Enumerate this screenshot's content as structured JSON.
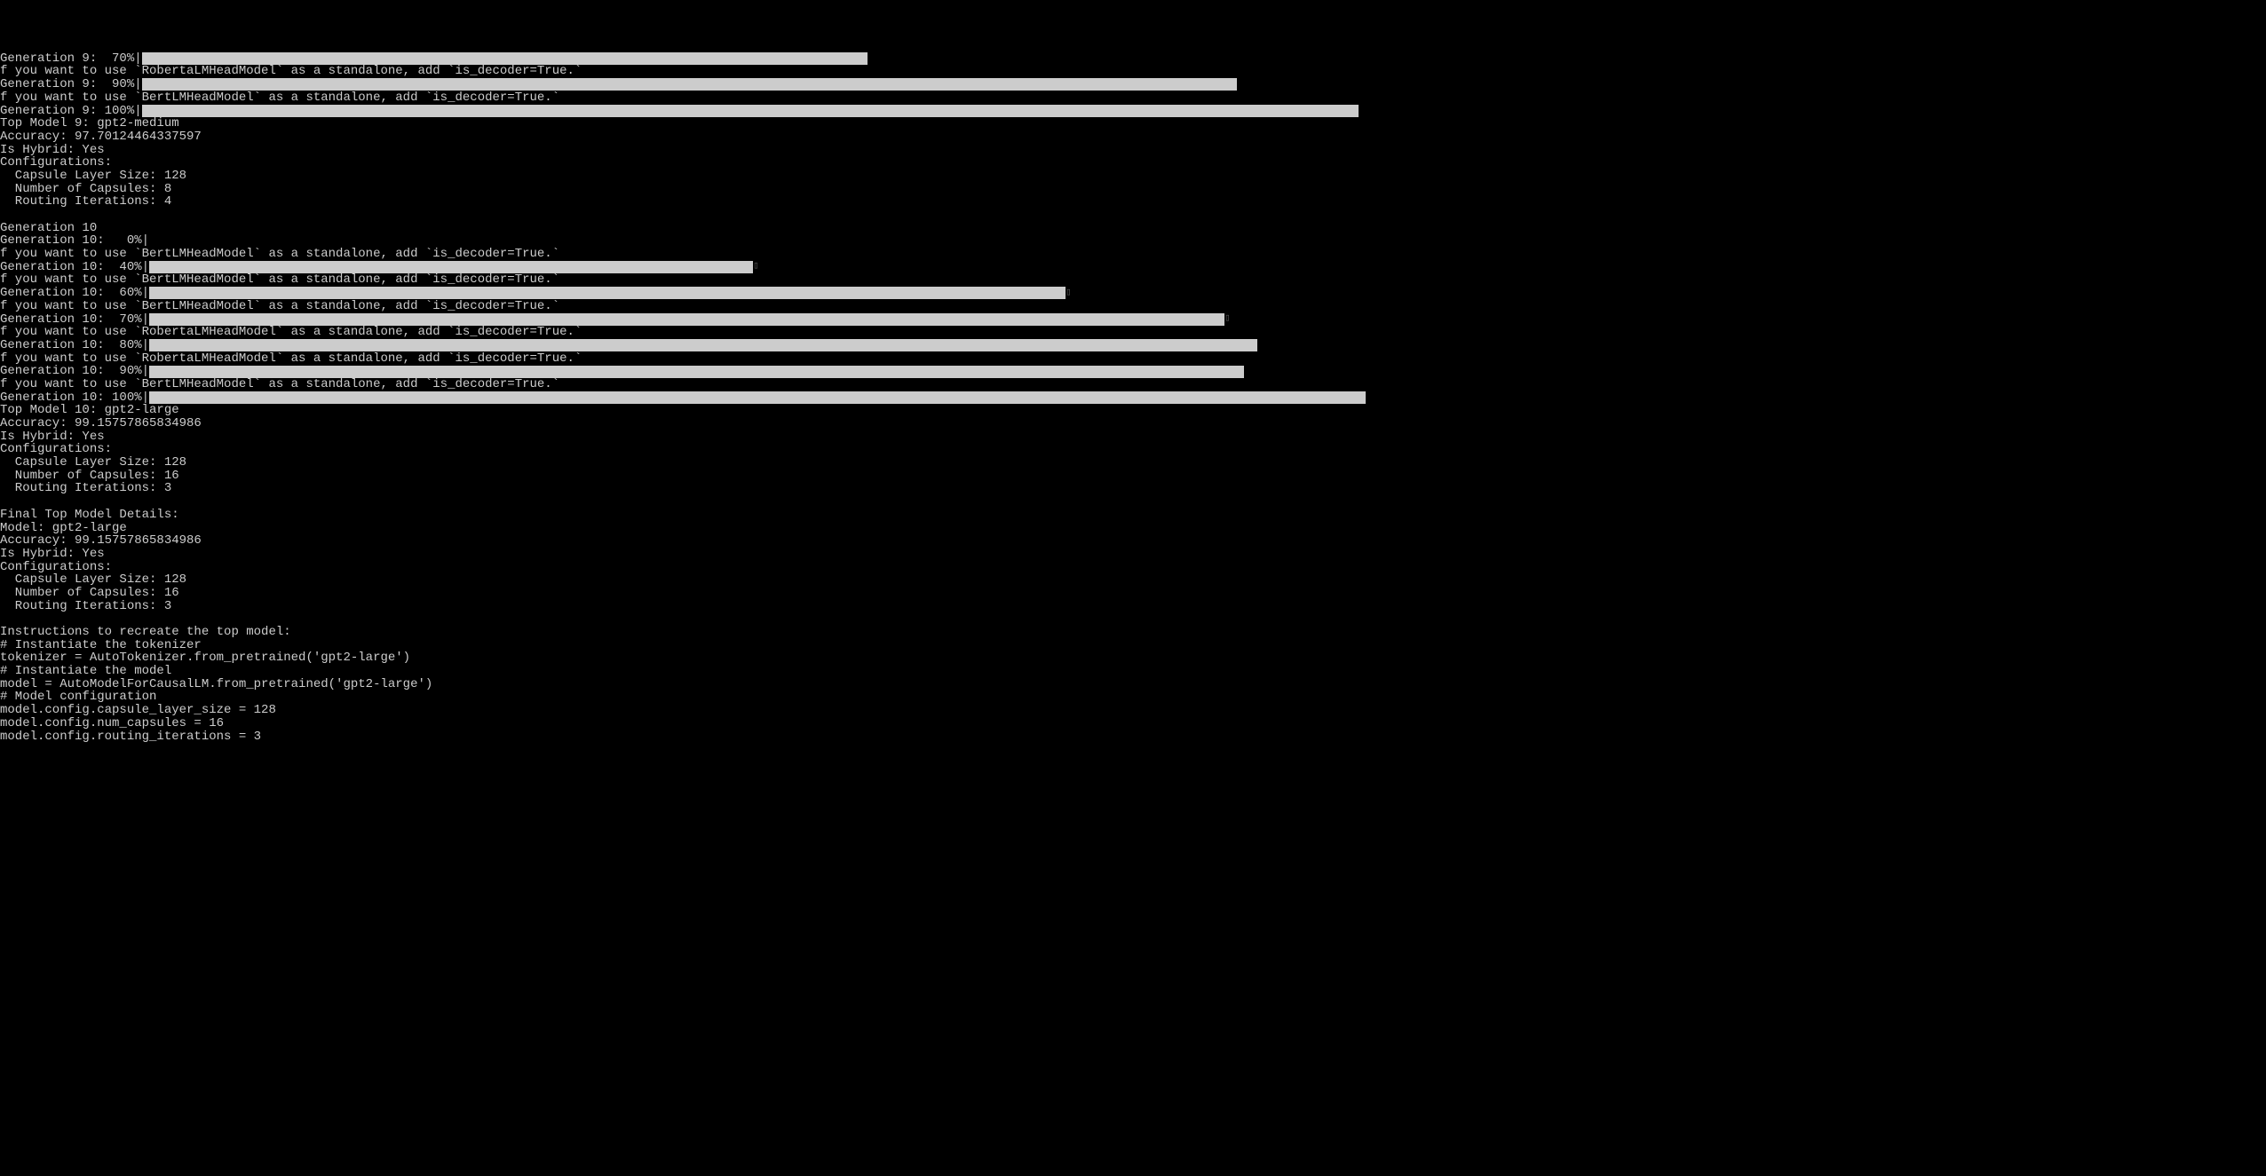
{
  "terminal_width": 1510,
  "lines": [
    {
      "type": "progress",
      "gen": "Generation 9:  70%",
      "percent": 70,
      "max_width": 1307,
      "end": false
    },
    {
      "type": "text",
      "content": "f you want to use `RobertaLMHeadModel` as a standalone, add `is_decoder=True.`"
    },
    {
      "type": "progress",
      "gen": "Generation 9:  90%",
      "percent": 90,
      "max_width": 1510,
      "end": false
    },
    {
      "type": "text",
      "content": "f you want to use `BertLMHeadModel` as a standalone, add `is_decoder=True.`"
    },
    {
      "type": "progress",
      "gen": "Generation 9: 100%",
      "percent": 100,
      "max_width": 1510,
      "end": false
    },
    {
      "type": "text",
      "content": "Top Model 9: gpt2-medium"
    },
    {
      "type": "text",
      "content": "Accuracy: 97.70124464337597"
    },
    {
      "type": "text",
      "content": "Is Hybrid: Yes"
    },
    {
      "type": "text",
      "content": "Configurations:"
    },
    {
      "type": "text",
      "content": "  Capsule Layer Size: 128"
    },
    {
      "type": "text",
      "content": "  Number of Capsules: 8"
    },
    {
      "type": "text",
      "content": "  Routing Iterations: 4"
    },
    {
      "type": "blank"
    },
    {
      "type": "text",
      "content": "Generation 10"
    },
    {
      "type": "progress",
      "gen": "Generation 10:   0%",
      "percent": 0,
      "max_width": 1510,
      "end": false
    },
    {
      "type": "text",
      "content": "f you want to use `BertLMHeadModel` as a standalone, add `is_decoder=True.`"
    },
    {
      "type": "progress",
      "gen": "Generation 10:  40%",
      "percent": 40,
      "max_width": 1840,
      "end": true
    },
    {
      "type": "text",
      "content": "f you want to use `BertLMHeadModel` as a standalone, add `is_decoder=True.`"
    },
    {
      "type": "progress",
      "gen": "Generation 10:  60%",
      "percent": 60,
      "max_width": 1860,
      "end": true
    },
    {
      "type": "text",
      "content": "f you want to use `BertLMHeadModel` as a standalone, add `is_decoder=True.`"
    },
    {
      "type": "progress",
      "gen": "Generation 10:  70%",
      "percent": 70,
      "max_width": 1870,
      "end": true
    },
    {
      "type": "text",
      "content": "f you want to use `RobertaLMHeadModel` as a standalone, add `is_decoder=True.`"
    },
    {
      "type": "progress",
      "gen": "Generation 10:  80%",
      "percent": 80,
      "max_width": 1700,
      "end": false
    },
    {
      "type": "text",
      "content": "f you want to use `RobertaLMHeadModel` as a standalone, add `is_decoder=True.`"
    },
    {
      "type": "progress",
      "gen": "Generation 10:  90%",
      "percent": 90,
      "max_width": 1510,
      "end": false
    },
    {
      "type": "text",
      "content": "f you want to use `BertLMHeadModel` as a standalone, add `is_decoder=True.`"
    },
    {
      "type": "progress",
      "gen": "Generation 10: 100%",
      "percent": 100,
      "max_width": 1510,
      "end": false
    },
    {
      "type": "text",
      "content": "Top Model 10: gpt2-large"
    },
    {
      "type": "text",
      "content": "Accuracy: 99.15757865834986"
    },
    {
      "type": "text",
      "content": "Is Hybrid: Yes"
    },
    {
      "type": "text",
      "content": "Configurations:"
    },
    {
      "type": "text",
      "content": "  Capsule Layer Size: 128"
    },
    {
      "type": "text",
      "content": "  Number of Capsules: 16"
    },
    {
      "type": "text",
      "content": "  Routing Iterations: 3"
    },
    {
      "type": "blank"
    },
    {
      "type": "text",
      "content": "Final Top Model Details:"
    },
    {
      "type": "text",
      "content": "Model: gpt2-large"
    },
    {
      "type": "text",
      "content": "Accuracy: 99.15757865834986"
    },
    {
      "type": "text",
      "content": "Is Hybrid: Yes"
    },
    {
      "type": "text",
      "content": "Configurations:"
    },
    {
      "type": "text",
      "content": "  Capsule Layer Size: 128"
    },
    {
      "type": "text",
      "content": "  Number of Capsules: 16"
    },
    {
      "type": "text",
      "content": "  Routing Iterations: 3"
    },
    {
      "type": "blank"
    },
    {
      "type": "text",
      "content": "Instructions to recreate the top model:"
    },
    {
      "type": "text",
      "content": "# Instantiate the tokenizer"
    },
    {
      "type": "text",
      "content": "tokenizer = AutoTokenizer.from_pretrained('gpt2-large')"
    },
    {
      "type": "text",
      "content": "# Instantiate the model"
    },
    {
      "type": "text",
      "content": "model = AutoModelForCausalLM.from_pretrained('gpt2-large')"
    },
    {
      "type": "text",
      "content": "# Model configuration"
    },
    {
      "type": "text",
      "content": "model.config.capsule_layer_size = 128"
    },
    {
      "type": "text",
      "content": "model.config.num_capsules = 16"
    },
    {
      "type": "text",
      "content": "model.config.routing_iterations = 3"
    }
  ]
}
